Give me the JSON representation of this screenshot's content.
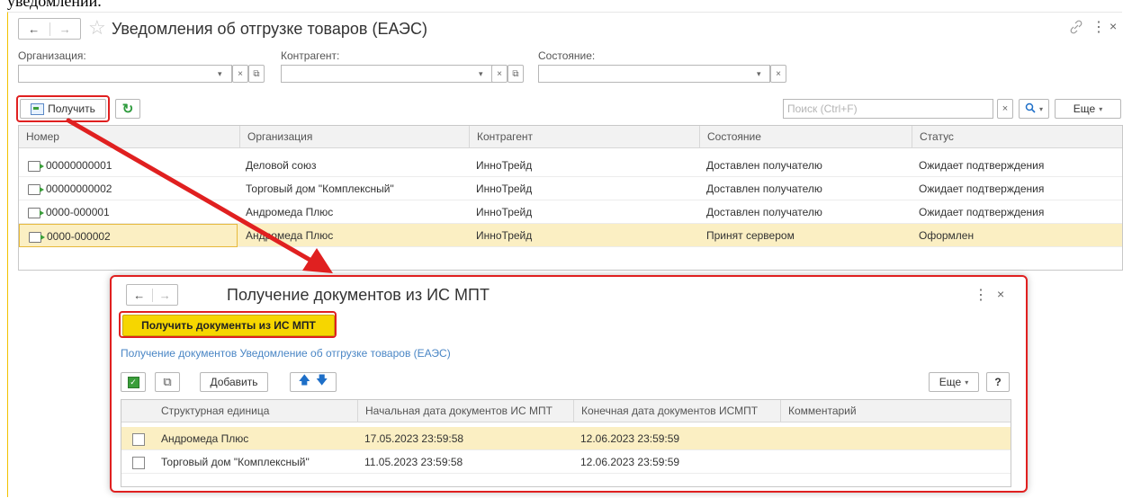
{
  "top_fragment": "уведомлений.",
  "window": {
    "nav_back": "←",
    "nav_forward": "→",
    "title": "Уведомления об отгрузке товаров (ЕАЭС)"
  },
  "filters": {
    "organization_label": "Организация:",
    "counterparty_label": "Контрагент:",
    "state_label": "Состояние:"
  },
  "toolbar": {
    "receive_label": "Получить",
    "search_placeholder": "Поиск (Ctrl+F)",
    "search_clear": "×",
    "more_label": "Еще"
  },
  "table": {
    "columns": [
      "Номер",
      "Организация",
      "Контрагент",
      "Состояние",
      "Статус"
    ],
    "rows": [
      {
        "number": "00000000001",
        "org": "Деловой союз",
        "counterparty": "ИнноТрейд",
        "state": "Доставлен получателю",
        "status": "Ожидает подтверждения"
      },
      {
        "number": "00000000002",
        "org": "Торговый дом \"Комплексный\"",
        "counterparty": "ИнноТрейд",
        "state": "Доставлен получателю",
        "status": "Ожидает подтверждения"
      },
      {
        "number": "0000-000001",
        "org": "Андромеда Плюс",
        "counterparty": "ИнноТрейд",
        "state": "Доставлен получателю",
        "status": "Ожидает подтверждения"
      },
      {
        "number": "0000-000002",
        "org": "Андромеда Плюс",
        "counterparty": "ИнноТрейд",
        "state": "Принят сервером",
        "status": "Оформлен"
      }
    ]
  },
  "popup": {
    "nav_back": "←",
    "nav_forward": "→",
    "title": "Получение документов из ИС МПТ",
    "main_button": "Получить документы из ИС МПТ",
    "link": "Получение документов Уведомление об отгрузке товаров (ЕАЭС)",
    "add_label": "Добавить",
    "more_label": "Еще",
    "help_label": "?",
    "menu_dots": "⋮",
    "close": "×",
    "columns": [
      "Структурная единица",
      "Начальная дата документов ИС МПТ",
      "Конечная дата документов ИСМПТ",
      "Комментарий"
    ],
    "rows": [
      {
        "unit": "Андромеда Плюс",
        "start": "17.05.2023 23:59:58",
        "end": "12.06.2023 23:59:59",
        "comment": ""
      },
      {
        "unit": "Торговый дом \"Комплексный\"",
        "start": "11.05.2023 23:59:58",
        "end": "12.06.2023 23:59:59",
        "comment": ""
      }
    ]
  },
  "colors": {
    "highlight_red": "#e02020",
    "selected_row": "#fbefc3",
    "yellow_button": "#f6d600"
  }
}
